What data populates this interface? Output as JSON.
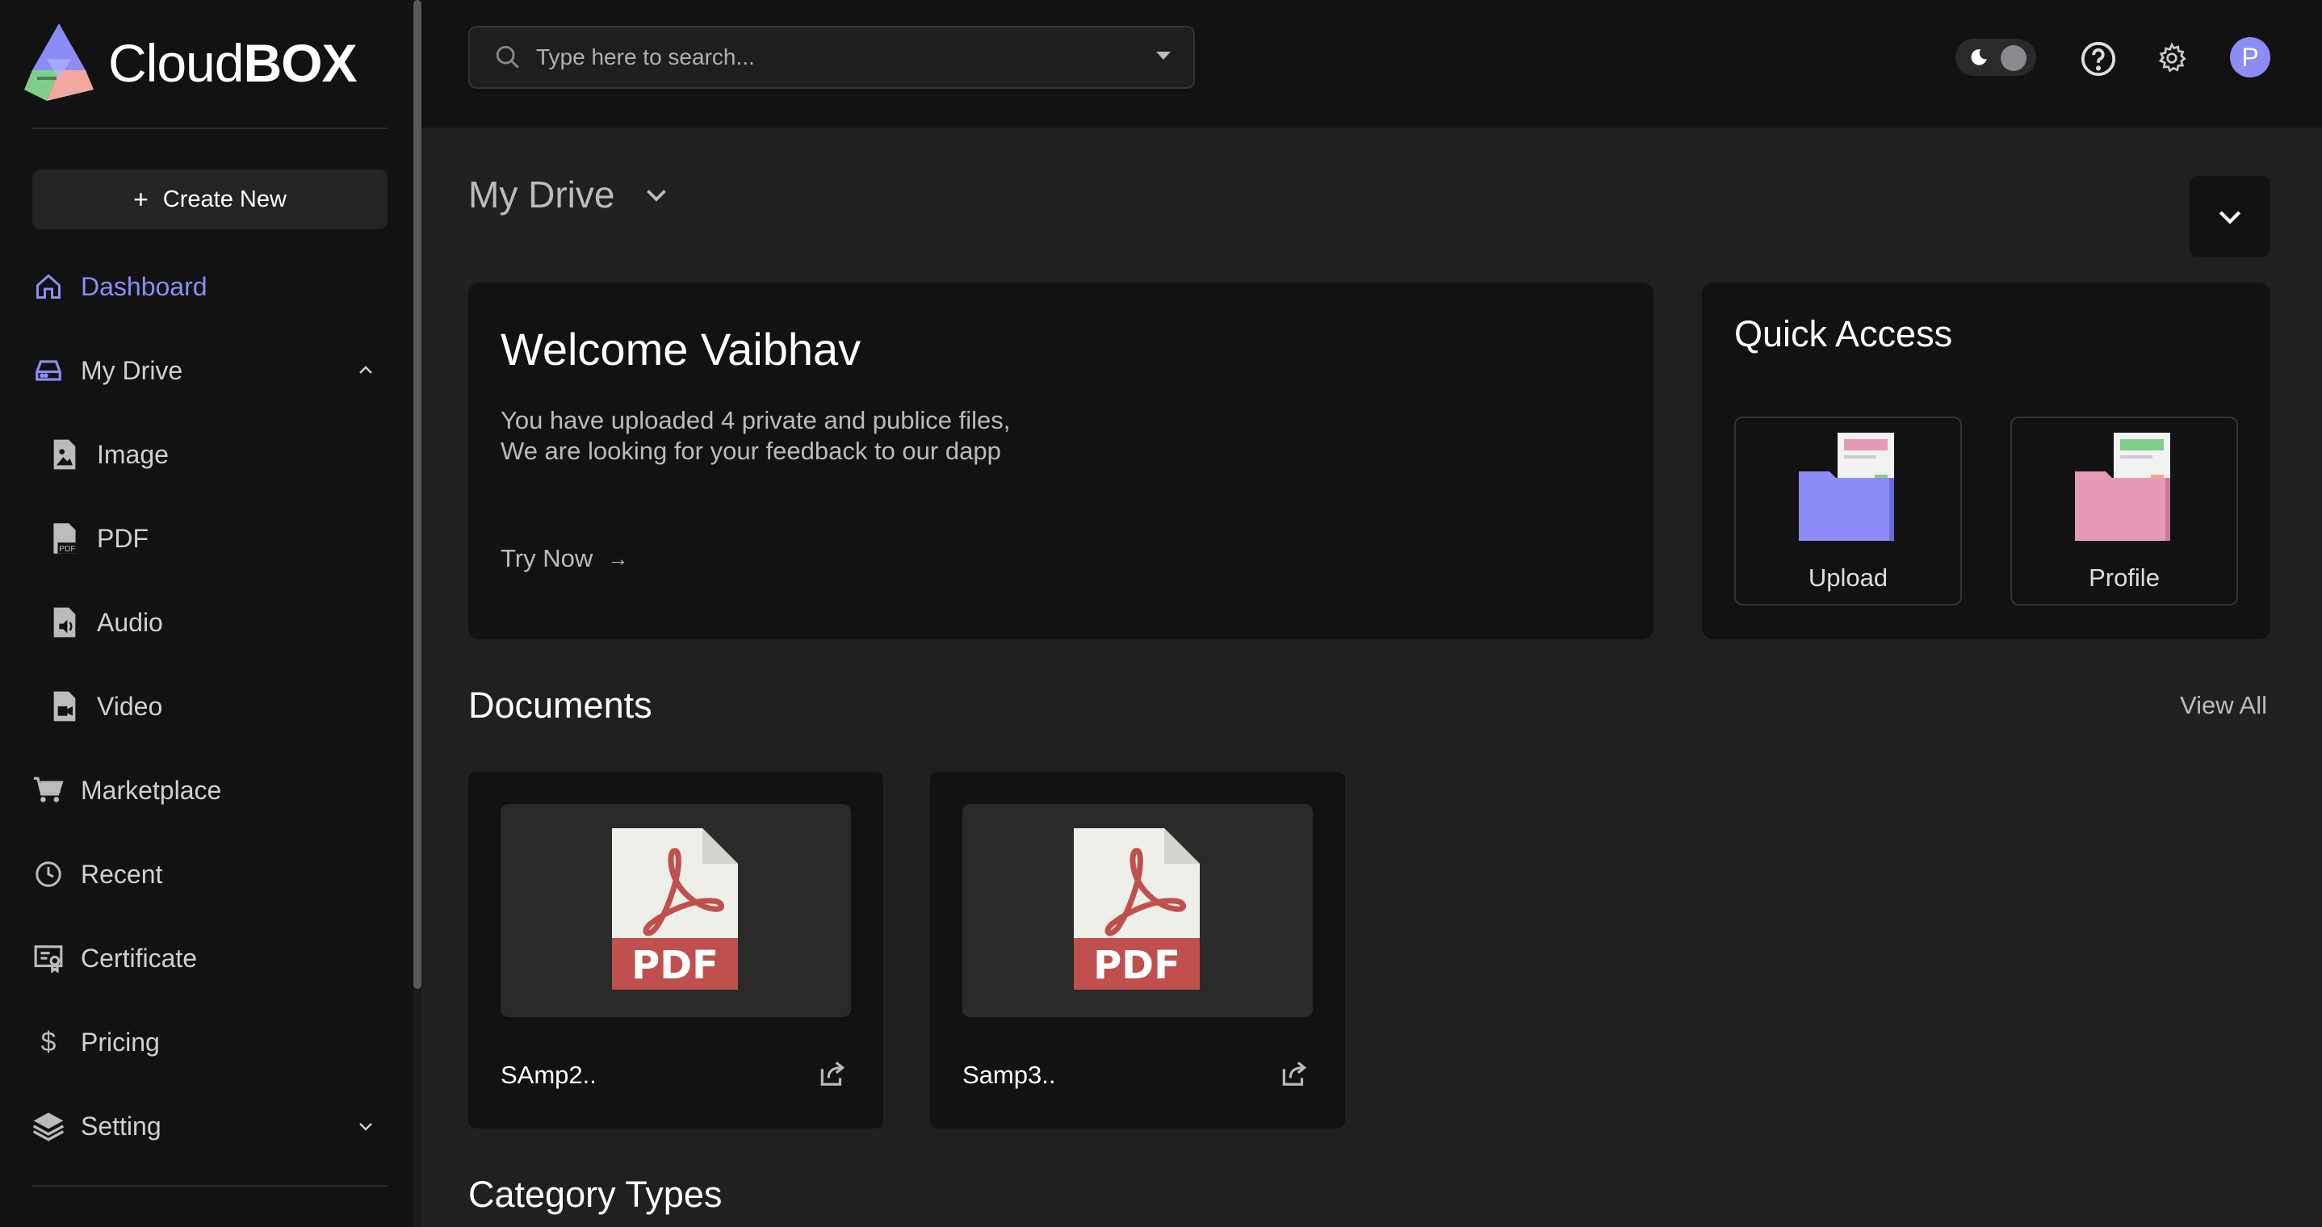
{
  "brand": {
    "name_regular": "Cloud",
    "name_bold": "BOX"
  },
  "sidebar": {
    "create_label": "Create New",
    "items": [
      {
        "label": "Dashboard",
        "icon": "home-icon",
        "active": true
      },
      {
        "label": "My Drive",
        "icon": "drive-icon",
        "expanded": true
      },
      {
        "label": "Image",
        "icon": "image-file-icon"
      },
      {
        "label": "PDF",
        "icon": "pdf-file-icon"
      },
      {
        "label": "Audio",
        "icon": "audio-file-icon"
      },
      {
        "label": "Video",
        "icon": "video-file-icon"
      },
      {
        "label": "Marketplace",
        "icon": "cart-icon"
      },
      {
        "label": "Recent",
        "icon": "clock-icon"
      },
      {
        "label": "Certificate",
        "icon": "certificate-icon"
      },
      {
        "label": "Pricing",
        "icon": "dollar-icon"
      },
      {
        "label": "Setting",
        "icon": "layers-icon"
      }
    ]
  },
  "search": {
    "placeholder": "Type here to search..."
  },
  "header": {
    "avatar_initial": "P"
  },
  "main": {
    "title": "My Drive",
    "welcome": {
      "title": "Welcome Vaibhav",
      "line1": "You have uploaded 4 private and publice files,",
      "line2": "We are looking for your feedback to our dapp",
      "cta": "Try Now",
      "cta_arrow": "→"
    },
    "quick_access": {
      "title": "Quick Access",
      "items": [
        {
          "label": "Upload",
          "icon": "purple-folder-icon"
        },
        {
          "label": "Profile",
          "icon": "pink-folder-icon"
        }
      ]
    },
    "documents": {
      "title": "Documents",
      "view_all": "View All",
      "items": [
        {
          "name": "SAmp2..",
          "type_label": "PDF"
        },
        {
          "name": "Samp3..",
          "type_label": "PDF"
        }
      ]
    },
    "category_title": "Category Types"
  },
  "colors": {
    "accent": "#8c8cf5",
    "background": "#202022",
    "panel": "#121212",
    "pdf_red": "#c0504d"
  }
}
